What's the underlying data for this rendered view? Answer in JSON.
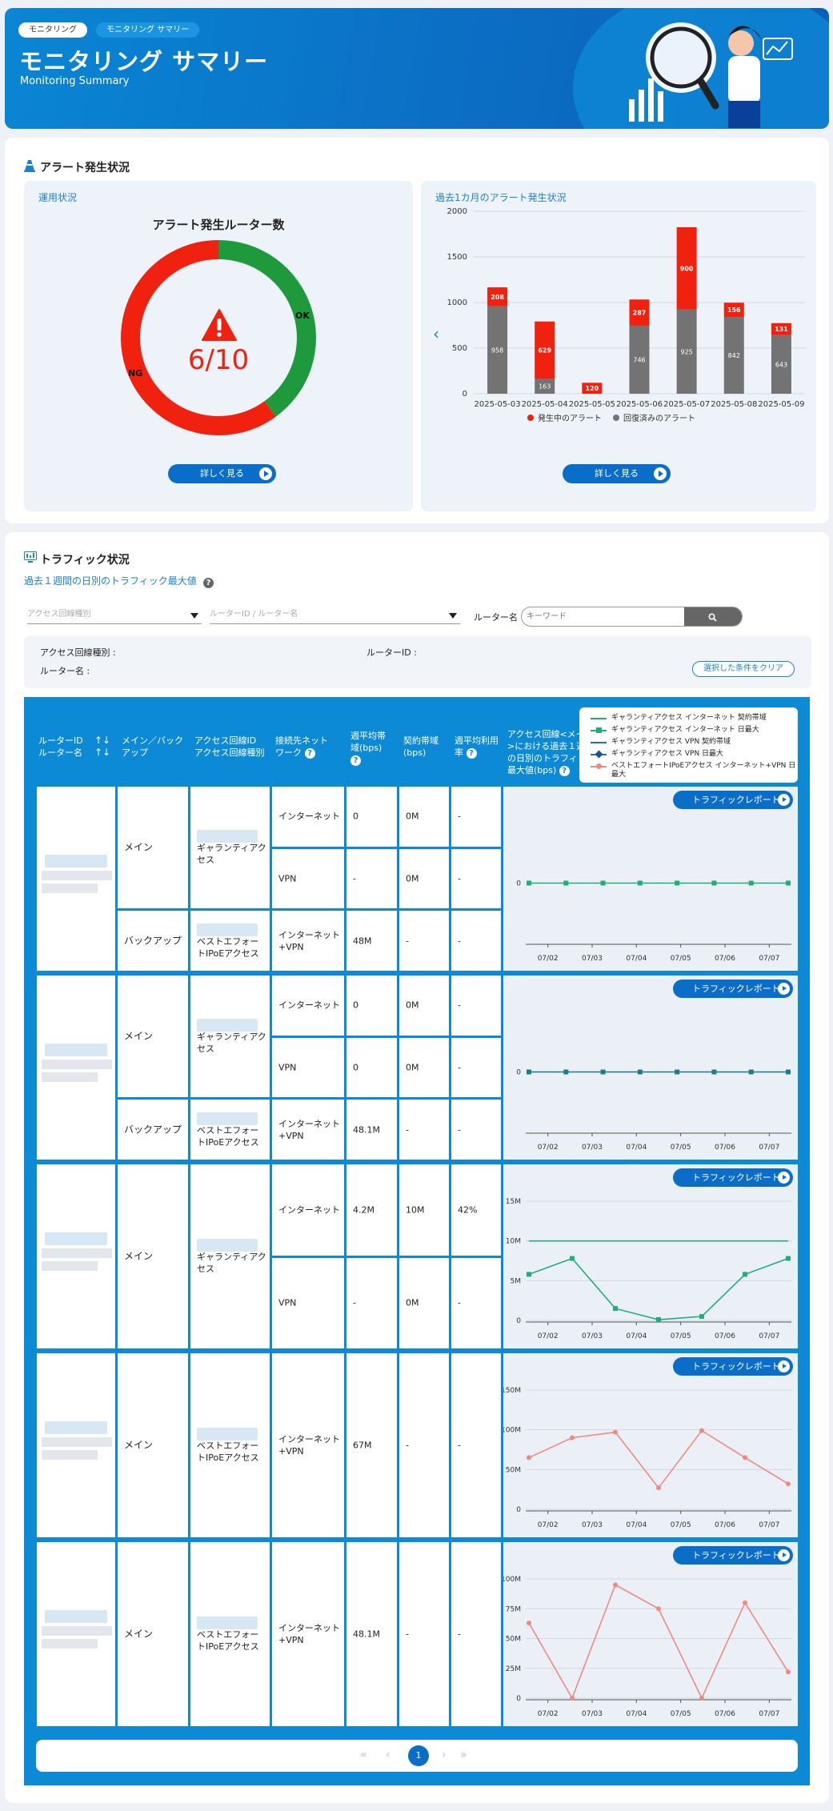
{
  "header": {
    "breadcrumbs": [
      "モニタリング",
      "モニタリング サマリー"
    ],
    "title": "モニタリング サマリー",
    "subtitle": "Monitoring Summary"
  },
  "alert_section": {
    "title": "アラート発生状況",
    "status_panel": {
      "heading": "運用状況",
      "chart_title": "アラート発生ルーター数",
      "value_text": "6/10",
      "ok_label": "OK",
      "ng_label": "NG",
      "details_button": "詳しく見る"
    },
    "history_panel": {
      "heading": "過去1カ月のアラート発生状況",
      "details_button": "詳しく見る",
      "legend": [
        "発生中のアラート",
        "回復済みのアラート"
      ]
    }
  },
  "traffic_section": {
    "title": "トラフィック状況",
    "subtitle": "過去１週間の日別のトラフィック最大値",
    "filters": {
      "line_type_placeholder": "アクセス回線種別",
      "router_placeholder": "ルーターID / ルーター名",
      "router_name_label": "ルーター名",
      "keyword_placeholder": "キーワード"
    },
    "conditions": {
      "line_type": "アクセス回線種別 :",
      "router_id": "ルーターID :",
      "router_name": "ルーター名 :",
      "clear_button": "選択した条件をクリア"
    },
    "table_headers": {
      "router": [
        "ルーターID",
        "ルーター名"
      ],
      "main_backup": "メイン／バックアップ",
      "line_id": [
        "アクセス回線ID",
        "アクセス回線種別"
      ],
      "network": "接続先ネットワーク",
      "avg_bandwidth": "週平均帯域(bps)",
      "contract": "契約帯域(bps)",
      "utilization": "週平均利用率",
      "daily_max": "アクセス回線<メイン>における過去１週間の日別のトラフィック最大値(bps)"
    },
    "legend": [
      "ギャランティアクセス インターネット 契約帯域",
      "ギャランティアクセス インターネット 日最大",
      "ギャランティアクセス VPN 契約帯域",
      "ギャランティアクセス VPN 日最大",
      "ベストエフォートIPoEアクセス インターネット+VPN 日最大"
    ],
    "report_button": "トラフィックレポート",
    "rows": [
      {
        "sub": [
          {
            "role": "メイン",
            "line_type": "ギャランティアクセス",
            "lines": [
              {
                "network": "インターネット",
                "avg": "0",
                "contract": "0M",
                "util": "-"
              },
              {
                "network": "VPN",
                "avg": "-",
                "contract": "0M",
                "util": "-"
              }
            ]
          },
          {
            "role": "バックアップ",
            "line_type": "ベストエフォートIPoEアクセス",
            "lines": [
              {
                "network": "インターネット+VPN",
                "avg": "48M",
                "contract": "-",
                "util": "-"
              }
            ]
          }
        ]
      },
      {
        "sub": [
          {
            "role": "メイン",
            "line_type": "ギャランティアクセス",
            "lines": [
              {
                "network": "インターネット",
                "avg": "0",
                "contract": "0M",
                "util": "-"
              },
              {
                "network": "VPN",
                "avg": "0",
                "contract": "0M",
                "util": "-"
              }
            ]
          },
          {
            "role": "バックアップ",
            "line_type": "ベストエフォートIPoEアクセス",
            "lines": [
              {
                "network": "インターネット+VPN",
                "avg": "48.1M",
                "contract": "-",
                "util": "-"
              }
            ]
          }
        ]
      },
      {
        "sub": [
          {
            "role": "メイン",
            "line_type": "ギャランティアクセス",
            "lines": [
              {
                "network": "インターネット",
                "avg": "4.2M",
                "contract": "10M",
                "util": "42%"
              },
              {
                "network": "VPN",
                "avg": "-",
                "contract": "0M",
                "util": "-"
              }
            ]
          }
        ]
      },
      {
        "sub": [
          {
            "role": "メイン",
            "line_type": "ベストエフォートIPoEアクセス",
            "lines": [
              {
                "network": "インターネット+VPN",
                "avg": "67M",
                "contract": "-",
                "util": "-"
              }
            ]
          }
        ]
      },
      {
        "sub": [
          {
            "role": "メイン",
            "line_type": "ベストエフォートIPoEアクセス",
            "lines": [
              {
                "network": "インターネット+VPN",
                "avg": "48.1M",
                "contract": "-",
                "util": "-"
              }
            ]
          }
        ]
      }
    ],
    "pagination": {
      "current_page": "1"
    }
  },
  "colors": {
    "accent": "#0a6ec8",
    "ok": "#1e9a3c",
    "ng": "#f0220f",
    "guarantee": "#1fae77",
    "vpn": "#1a7d8a",
    "besteffort": "#f08a80"
  },
  "chart_data": [
    {
      "type": "pie",
      "title": "アラート発生ルーター数",
      "categories": [
        "NG",
        "OK"
      ],
      "values": [
        6,
        4
      ]
    },
    {
      "type": "bar",
      "stacked": true,
      "categories": [
        "2025-05-03",
        "2025-05-04",
        "2025-05-05",
        "2025-05-06",
        "2025-05-07",
        "2025-05-08",
        "2025-05-09"
      ],
      "series": [
        {
          "name": "回復済みのアラート",
          "values": [
            958,
            163,
            0,
            746,
            925,
            842,
            643
          ]
        },
        {
          "name": "発生中のアラート",
          "values": [
            208,
            629,
            120,
            287,
            900,
            156,
            131
          ]
        }
      ],
      "ylim": [
        0,
        2000
      ],
      "yticks": [
        0,
        500,
        1000,
        1500,
        2000
      ],
      "legend": "bottom"
    },
    {
      "type": "line",
      "categories": [
        "07/02",
        "07/03",
        "07/04",
        "07/05",
        "07/06",
        "07/07"
      ],
      "yticks": [
        "0"
      ],
      "ylim": [
        0,
        1
      ],
      "series": [
        {
          "name": "ギャランティアクセス インターネット 日最大",
          "values": [
            0,
            0,
            0,
            0,
            0,
            0,
            0,
            0
          ]
        }
      ]
    },
    {
      "type": "line",
      "categories": [
        "07/02",
        "07/03",
        "07/04",
        "07/05",
        "07/06",
        "07/07"
      ],
      "yticks": [
        "0"
      ],
      "ylim": [
        0,
        1
      ],
      "series": [
        {
          "name": "ギャランティアクセス VPN 日最大",
          "values": [
            0,
            0,
            0,
            0,
            0,
            0,
            0,
            0
          ]
        }
      ]
    },
    {
      "type": "line",
      "categories": [
        "07/02",
        "07/03",
        "07/04",
        "07/05",
        "07/06",
        "07/07"
      ],
      "yticks": [
        "0",
        "5M",
        "10M",
        "15M"
      ],
      "ylim": [
        0,
        15
      ],
      "series": [
        {
          "name": "ギャランティアクセス インターネット 契約帯域",
          "values": [
            10,
            10,
            10,
            10,
            10,
            10,
            10
          ]
        },
        {
          "name": "ギャランティアクセス インターネット 日最大",
          "values": [
            5.8,
            7.8,
            1.5,
            0.1,
            0.5,
            5.8,
            7.8
          ]
        }
      ]
    },
    {
      "type": "line",
      "categories": [
        "07/02",
        "07/03",
        "07/04",
        "07/05",
        "07/06",
        "07/07"
      ],
      "yticks": [
        "0",
        "50M",
        "100M",
        "150M"
      ],
      "ylim": [
        0,
        150
      ],
      "series": [
        {
          "name": "ベストエフォートIPoEアクセス インターネット+VPN 日最大",
          "values": [
            65,
            90,
            97,
            27,
            99,
            65,
            32
          ]
        }
      ]
    },
    {
      "type": "line",
      "categories": [
        "07/02",
        "07/03",
        "07/04",
        "07/05",
        "07/06",
        "07/07"
      ],
      "yticks": [
        "0",
        "25M",
        "50M",
        "75M",
        "100M"
      ],
      "ylim": [
        0,
        100
      ],
      "series": [
        {
          "name": "ベストエフォートIPoEアクセス インターネット+VPN 日最大",
          "values": [
            63,
            0,
            95,
            75,
            0,
            80,
            22
          ]
        }
      ]
    }
  ]
}
